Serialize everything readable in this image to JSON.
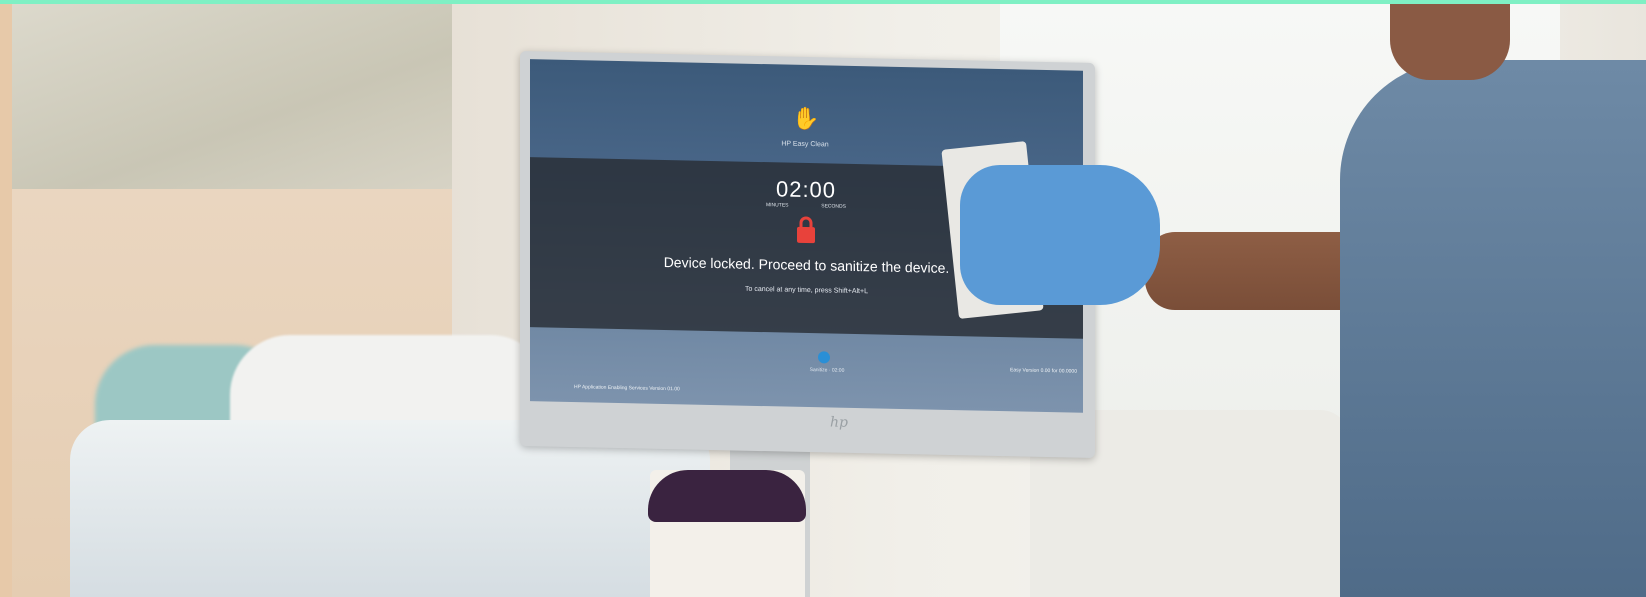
{
  "colors": {
    "top_bar": "#7ff0c4",
    "lock": "#e8423b",
    "glove": "#5a9ad6",
    "screen_band": "#2e333a"
  },
  "screen": {
    "app_icon": "hand-sparkle-icon",
    "app_name": "HP Easy Clean",
    "timer": "02:00",
    "timer_units": [
      "MINUTES",
      "SECONDS"
    ],
    "lock_icon": "padlock-icon",
    "message": "Device locked. Proceed to sanitize the device.",
    "cancel_hint": "To cancel at any time, press Shift+Alt+L",
    "bottom_label": "Sanitize · 02:00",
    "footer_left": "HP Application Enabling Services Version 01.00",
    "footer_right": "Easy Version 0.00 for 00.0000"
  },
  "bezel": {
    "logo": "hp-logo-icon",
    "logo_text": "hp"
  }
}
